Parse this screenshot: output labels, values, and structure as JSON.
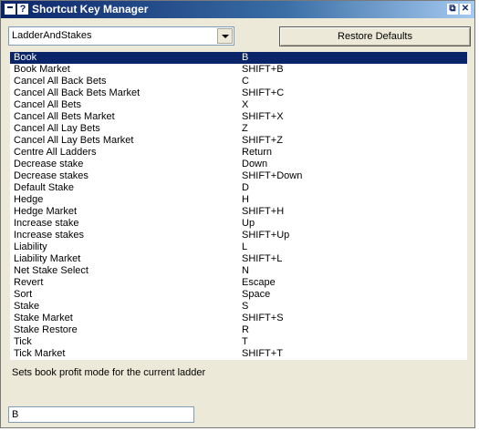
{
  "window": {
    "title": "Shortcut Key Manager",
    "icons": {
      "menu": "window-menu-icon",
      "help": "help-icon",
      "restore": "restore-icon",
      "close": "close-icon"
    },
    "help_glyph": "?",
    "restore_glyph": "⧉",
    "close_glyph": "✕"
  },
  "toolbar": {
    "profile_select_value": "LadderAndStakes",
    "restore_defaults_label": "Restore Defaults"
  },
  "shortcuts": [
    {
      "name": "Book",
      "key": "B",
      "selected": true
    },
    {
      "name": "Book Market",
      "key": "SHIFT+B"
    },
    {
      "name": "Cancel All Back Bets",
      "key": "C"
    },
    {
      "name": "Cancel All Back Bets Market",
      "key": "SHIFT+C"
    },
    {
      "name": "Cancel All Bets",
      "key": "X"
    },
    {
      "name": "Cancel All Bets Market",
      "key": "SHIFT+X"
    },
    {
      "name": "Cancel All Lay Bets",
      "key": "Z"
    },
    {
      "name": "Cancel All Lay Bets Market",
      "key": "SHIFT+Z"
    },
    {
      "name": "Centre All Ladders",
      "key": "Return"
    },
    {
      "name": "Decrease stake",
      "key": "Down"
    },
    {
      "name": "Decrease stakes",
      "key": "SHIFT+Down"
    },
    {
      "name": "Default Stake",
      "key": "D"
    },
    {
      "name": "Hedge",
      "key": "H"
    },
    {
      "name": "Hedge Market",
      "key": "SHIFT+H"
    },
    {
      "name": "Increase stake",
      "key": "Up"
    },
    {
      "name": "Increase stakes",
      "key": "SHIFT+Up"
    },
    {
      "name": "Liability",
      "key": "L"
    },
    {
      "name": "Liability Market",
      "key": "SHIFT+L"
    },
    {
      "name": "Net Stake Select",
      "key": "N"
    },
    {
      "name": "Revert",
      "key": "Escape"
    },
    {
      "name": "Sort",
      "key": "Space"
    },
    {
      "name": "Stake",
      "key": "S"
    },
    {
      "name": "Stake Market",
      "key": "SHIFT+S"
    },
    {
      "name": "Stake Restore",
      "key": "R"
    },
    {
      "name": "Tick",
      "key": "T"
    },
    {
      "name": "Tick Market",
      "key": "SHIFT+T"
    }
  ],
  "description": "Sets book profit mode for the current ladder",
  "key_input": {
    "value": "B"
  },
  "colors": {
    "selection": "#0a246a",
    "titlebar": "#0a246a",
    "panel": "#ece9d8"
  }
}
